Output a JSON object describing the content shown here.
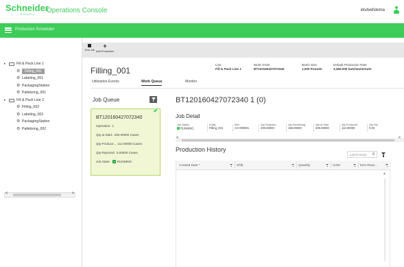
{
  "brand": {
    "logo_text": "Schneider",
    "logo_sub": "Electric",
    "app_title": "Operations Console",
    "user_name": "idsdwd\\dema",
    "accent_color": "#3dcd58"
  },
  "nav": {
    "label": "Production Scheduler"
  },
  "tree": {
    "nodes": [
      {
        "toggle": "▸",
        "label": "Fill & Pack Line 1",
        "type": "line"
      },
      {
        "label": "Filling_001",
        "type": "station",
        "selected": true
      },
      {
        "label": "Labeling_001",
        "type": "station"
      },
      {
        "label": "PackagingStation",
        "type": "station"
      },
      {
        "label": "Palletizing_001",
        "type": "station"
      },
      {
        "toggle": "▸",
        "label": "Fill & Pack Line 2",
        "type": "line"
      },
      {
        "label": "Filling_002",
        "type": "station"
      },
      {
        "label": "Labeling_002",
        "type": "station"
      },
      {
        "label": "PackagingStation",
        "type": "station"
      },
      {
        "label": "Palletizing_002",
        "type": "station"
      }
    ],
    "scroll_left": "<",
    "scroll_right": ">"
  },
  "toolbar": {
    "end_job": "End Job",
    "add_production": "Add Production"
  },
  "entity": {
    "name": "Filling_001",
    "line_label": "Line",
    "line_value": "Fill & Pack Line 1",
    "work_order_label": "Work Order",
    "work_order_value": "BT120160427072340",
    "batch_size_label": "Batch Size",
    "batch_size_value": "1,000 Pounds",
    "rate_label": "Default Production Rate",
    "rate_value": "3,360.000 batches/minute"
  },
  "tabs": [
    "Utilization Events",
    "Work Queue",
    "Monitor"
  ],
  "active_tab": 1,
  "job_queue": {
    "title": "Job Queue",
    "job": {
      "id": "BT120160427072340",
      "operation_label": "Operation:",
      "operation_value": "1",
      "qty_start_label": "Qty at Start:",
      "qty_start_value": "200.00000 Cases",
      "qty_produced_label": "Qty Produce...",
      "qty_produced_value": "112.00000 Cases",
      "qty_rejected_label": "Qty Rejected:",
      "qty_rejected_value": "0.00000 Cases",
      "state_label": "Job State:",
      "state_value": "RUNNING"
    }
  },
  "work_order": {
    "title": "BT120160427072340  1 (0)"
  },
  "job_detail": {
    "title": "Job Detail",
    "columns": [
      {
        "label": "Job Status",
        "value": "RUNNING"
      },
      {
        "label": "Entity",
        "value": "Filling_001"
      },
      {
        "label": "Item",
        "value": "CX-000001"
      },
      {
        "label": "Qty Required",
        "value": "200.00000"
      },
      {
        "label": "Qty Remaining",
        "value": "166.00000"
      },
      {
        "label": "Qty at Start",
        "value": "200.00000"
      },
      {
        "label": "Qty Produced",
        "value": "112.00000"
      },
      {
        "label": "Qty Rej",
        "value": "0.00"
      }
    ],
    "scroll_left": "<",
    "scroll_right": ">"
  },
  "production_history": {
    "title": "Production History",
    "range_select": "Last N Hours",
    "range_value": "8",
    "columns": [
      "Created Date *",
      "Shift",
      "Quantity",
      "UOM",
      "Item Reas..."
    ]
  }
}
